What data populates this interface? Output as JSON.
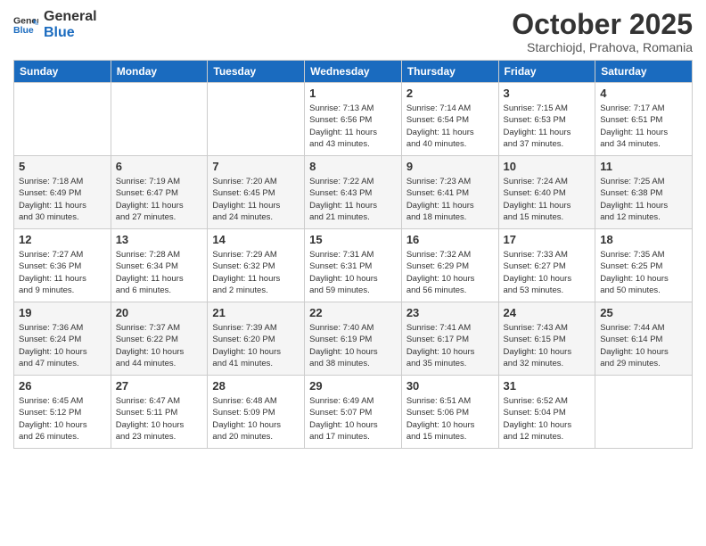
{
  "header": {
    "logo_general": "General",
    "logo_blue": "Blue",
    "month": "October 2025",
    "location": "Starchiojd, Prahova, Romania"
  },
  "days_of_week": [
    "Sunday",
    "Monday",
    "Tuesday",
    "Wednesday",
    "Thursday",
    "Friday",
    "Saturday"
  ],
  "weeks": [
    [
      {
        "day": "",
        "info": ""
      },
      {
        "day": "",
        "info": ""
      },
      {
        "day": "",
        "info": ""
      },
      {
        "day": "1",
        "info": "Sunrise: 7:13 AM\nSunset: 6:56 PM\nDaylight: 11 hours\nand 43 minutes."
      },
      {
        "day": "2",
        "info": "Sunrise: 7:14 AM\nSunset: 6:54 PM\nDaylight: 11 hours\nand 40 minutes."
      },
      {
        "day": "3",
        "info": "Sunrise: 7:15 AM\nSunset: 6:53 PM\nDaylight: 11 hours\nand 37 minutes."
      },
      {
        "day": "4",
        "info": "Sunrise: 7:17 AM\nSunset: 6:51 PM\nDaylight: 11 hours\nand 34 minutes."
      }
    ],
    [
      {
        "day": "5",
        "info": "Sunrise: 7:18 AM\nSunset: 6:49 PM\nDaylight: 11 hours\nand 30 minutes."
      },
      {
        "day": "6",
        "info": "Sunrise: 7:19 AM\nSunset: 6:47 PM\nDaylight: 11 hours\nand 27 minutes."
      },
      {
        "day": "7",
        "info": "Sunrise: 7:20 AM\nSunset: 6:45 PM\nDaylight: 11 hours\nand 24 minutes."
      },
      {
        "day": "8",
        "info": "Sunrise: 7:22 AM\nSunset: 6:43 PM\nDaylight: 11 hours\nand 21 minutes."
      },
      {
        "day": "9",
        "info": "Sunrise: 7:23 AM\nSunset: 6:41 PM\nDaylight: 11 hours\nand 18 minutes."
      },
      {
        "day": "10",
        "info": "Sunrise: 7:24 AM\nSunset: 6:40 PM\nDaylight: 11 hours\nand 15 minutes."
      },
      {
        "day": "11",
        "info": "Sunrise: 7:25 AM\nSunset: 6:38 PM\nDaylight: 11 hours\nand 12 minutes."
      }
    ],
    [
      {
        "day": "12",
        "info": "Sunrise: 7:27 AM\nSunset: 6:36 PM\nDaylight: 11 hours\nand 9 minutes."
      },
      {
        "day": "13",
        "info": "Sunrise: 7:28 AM\nSunset: 6:34 PM\nDaylight: 11 hours\nand 6 minutes."
      },
      {
        "day": "14",
        "info": "Sunrise: 7:29 AM\nSunset: 6:32 PM\nDaylight: 11 hours\nand 2 minutes."
      },
      {
        "day": "15",
        "info": "Sunrise: 7:31 AM\nSunset: 6:31 PM\nDaylight: 10 hours\nand 59 minutes."
      },
      {
        "day": "16",
        "info": "Sunrise: 7:32 AM\nSunset: 6:29 PM\nDaylight: 10 hours\nand 56 minutes."
      },
      {
        "day": "17",
        "info": "Sunrise: 7:33 AM\nSunset: 6:27 PM\nDaylight: 10 hours\nand 53 minutes."
      },
      {
        "day": "18",
        "info": "Sunrise: 7:35 AM\nSunset: 6:25 PM\nDaylight: 10 hours\nand 50 minutes."
      }
    ],
    [
      {
        "day": "19",
        "info": "Sunrise: 7:36 AM\nSunset: 6:24 PM\nDaylight: 10 hours\nand 47 minutes."
      },
      {
        "day": "20",
        "info": "Sunrise: 7:37 AM\nSunset: 6:22 PM\nDaylight: 10 hours\nand 44 minutes."
      },
      {
        "day": "21",
        "info": "Sunrise: 7:39 AM\nSunset: 6:20 PM\nDaylight: 10 hours\nand 41 minutes."
      },
      {
        "day": "22",
        "info": "Sunrise: 7:40 AM\nSunset: 6:19 PM\nDaylight: 10 hours\nand 38 minutes."
      },
      {
        "day": "23",
        "info": "Sunrise: 7:41 AM\nSunset: 6:17 PM\nDaylight: 10 hours\nand 35 minutes."
      },
      {
        "day": "24",
        "info": "Sunrise: 7:43 AM\nSunset: 6:15 PM\nDaylight: 10 hours\nand 32 minutes."
      },
      {
        "day": "25",
        "info": "Sunrise: 7:44 AM\nSunset: 6:14 PM\nDaylight: 10 hours\nand 29 minutes."
      }
    ],
    [
      {
        "day": "26",
        "info": "Sunrise: 6:45 AM\nSunset: 5:12 PM\nDaylight: 10 hours\nand 26 minutes."
      },
      {
        "day": "27",
        "info": "Sunrise: 6:47 AM\nSunset: 5:11 PM\nDaylight: 10 hours\nand 23 minutes."
      },
      {
        "day": "28",
        "info": "Sunrise: 6:48 AM\nSunset: 5:09 PM\nDaylight: 10 hours\nand 20 minutes."
      },
      {
        "day": "29",
        "info": "Sunrise: 6:49 AM\nSunset: 5:07 PM\nDaylight: 10 hours\nand 17 minutes."
      },
      {
        "day": "30",
        "info": "Sunrise: 6:51 AM\nSunset: 5:06 PM\nDaylight: 10 hours\nand 15 minutes."
      },
      {
        "day": "31",
        "info": "Sunrise: 6:52 AM\nSunset: 5:04 PM\nDaylight: 10 hours\nand 12 minutes."
      },
      {
        "day": "",
        "info": ""
      }
    ]
  ]
}
